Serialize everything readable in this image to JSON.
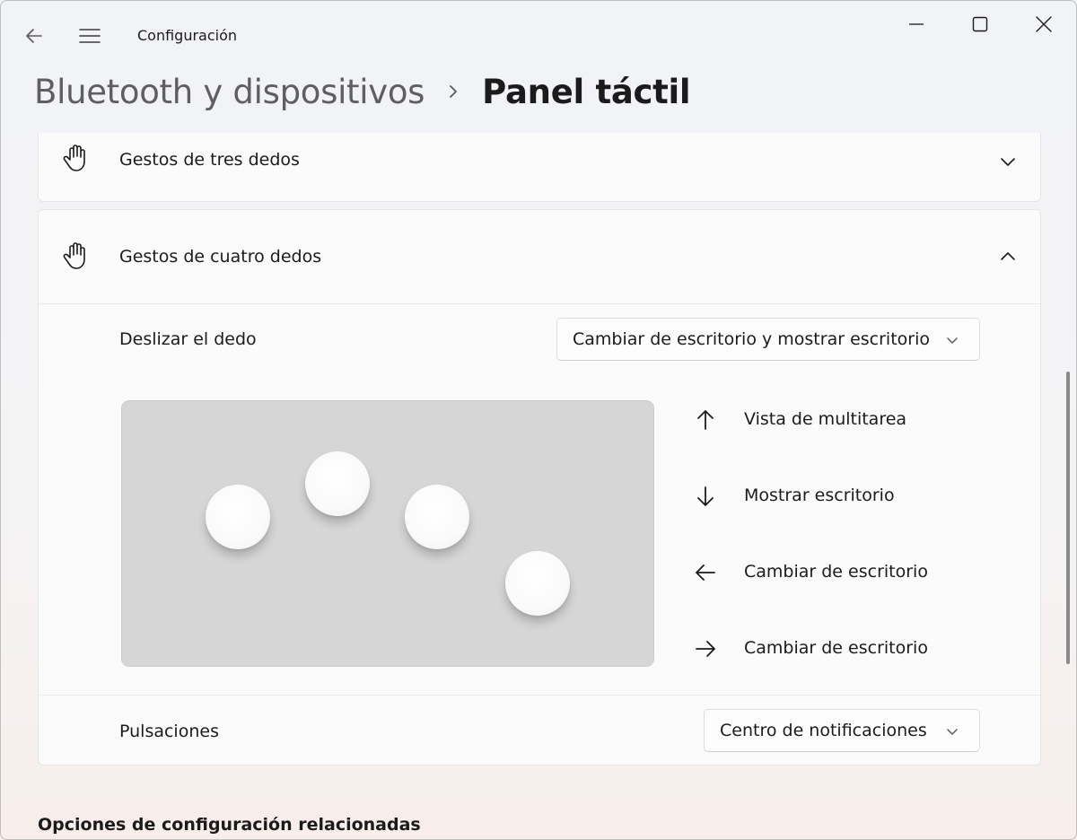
{
  "window": {
    "app_title": "Configuración"
  },
  "breadcrumb": {
    "parent": "Bluetooth y dispositivos",
    "current": "Panel táctil"
  },
  "three_finger": {
    "label": "Gestos de tres dedos",
    "expanded": false
  },
  "four_finger": {
    "label": "Gestos de cuatro dedos",
    "expanded": true,
    "swipe": {
      "label": "Deslizar el dedo",
      "selected": "Cambiar de escritorio y mostrar escritorio"
    },
    "gestures": [
      {
        "direction": "up",
        "label": "Vista de multitarea"
      },
      {
        "direction": "down",
        "label": "Mostrar escritorio"
      },
      {
        "direction": "left",
        "label": "Cambiar de escritorio"
      },
      {
        "direction": "right",
        "label": "Cambiar de escritorio"
      }
    ],
    "taps": {
      "label": "Pulsaciones",
      "selected": "Centro de notificaciones"
    }
  },
  "related": {
    "title": "Opciones de configuración relacionadas"
  },
  "icons": {
    "back": "back-arrow-icon",
    "menu": "hamburger-menu-icon",
    "minimize": "minimize-icon",
    "maximize": "maximize-icon",
    "close": "close-icon",
    "hand": "hand-icon",
    "chevron": "chevron-icon",
    "arrows": [
      "arrow-up-icon",
      "arrow-down-icon",
      "arrow-left-icon",
      "arrow-right-icon"
    ]
  },
  "colors": {
    "touchpad": "#d6d6d6",
    "card": "#fbfbfb",
    "text": "#1b1b1b",
    "breadcrumb_parent": "#5f5f5f"
  }
}
